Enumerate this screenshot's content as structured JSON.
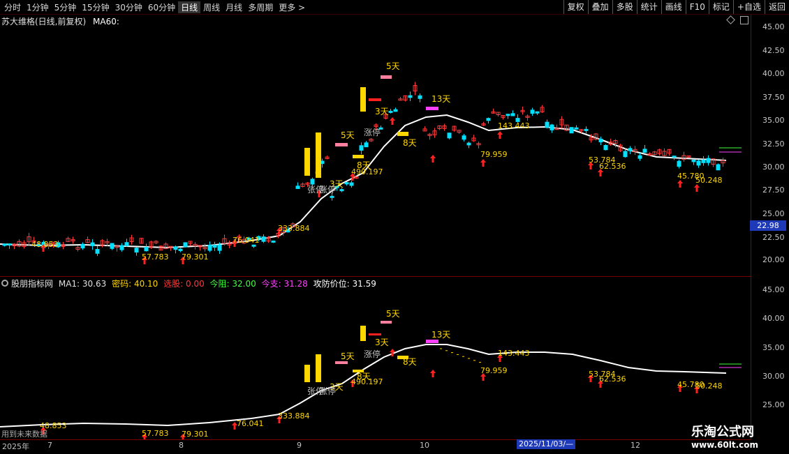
{
  "toolbar": {
    "periods": [
      "分时",
      "1分钟",
      "5分钟",
      "15分钟",
      "30分钟",
      "60分钟",
      "日线",
      "周线",
      "月线",
      "多周期",
      "更多 >"
    ],
    "active_period": "日线",
    "right_buttons": [
      "复权",
      "叠加",
      "多股",
      "统计",
      "画线",
      "F10",
      "标记",
      "+自选",
      "返回"
    ]
  },
  "main_panel": {
    "stock_title": "苏大维格(日线,前复权)",
    "ma_label": "MA60:",
    "current_price": "22.98",
    "price_axis": [
      "45.00",
      "42.50",
      "40.00",
      "37.50",
      "35.00",
      "32.50",
      "30.00",
      "27.50",
      "25.00",
      "22.50",
      "20.00"
    ]
  },
  "sub_panel": {
    "indicator_name": "股朋指标网",
    "ma1": "MA1: 30.63",
    "mima": "密码: 40.10",
    "xuangu": "选股: 0.00",
    "jinzu": "今阻: 32.00",
    "jinzhi": "今支: 31.28",
    "gongfang": "攻防价位: 31.59",
    "price_axis": [
      "45.00",
      "40.00",
      "35.00",
      "30.00",
      "25.00"
    ],
    "future_data": "用到未来数据"
  },
  "time_axis": {
    "months": [
      "2025年",
      "7",
      "8",
      "9",
      "10",
      "11",
      "12"
    ],
    "cursor_date": "2025/11/03/—"
  },
  "markers": {
    "values": [
      "48.853",
      "57.783",
      "79.301",
      "76.041",
      "333.884",
      "490.197",
      "79.959",
      "143.443",
      "53.784",
      "62.536",
      "45.780",
      "50.248"
    ],
    "days": [
      "5天",
      "13天",
      "5天",
      "3天",
      "3天",
      "8天",
      "8天"
    ],
    "limit_up": [
      "涨停",
      "张停",
      "涨停"
    ]
  },
  "watermark": {
    "line1": "乐淘公式网",
    "line2": "www.60lt.com"
  },
  "colors": {
    "up": "#ff3a3a",
    "down": "#00e0ff",
    "ma": "#ffffff",
    "yellow": "#ffd700",
    "magenta": "#ff40ff",
    "pink": "#ff7f9f"
  }
}
